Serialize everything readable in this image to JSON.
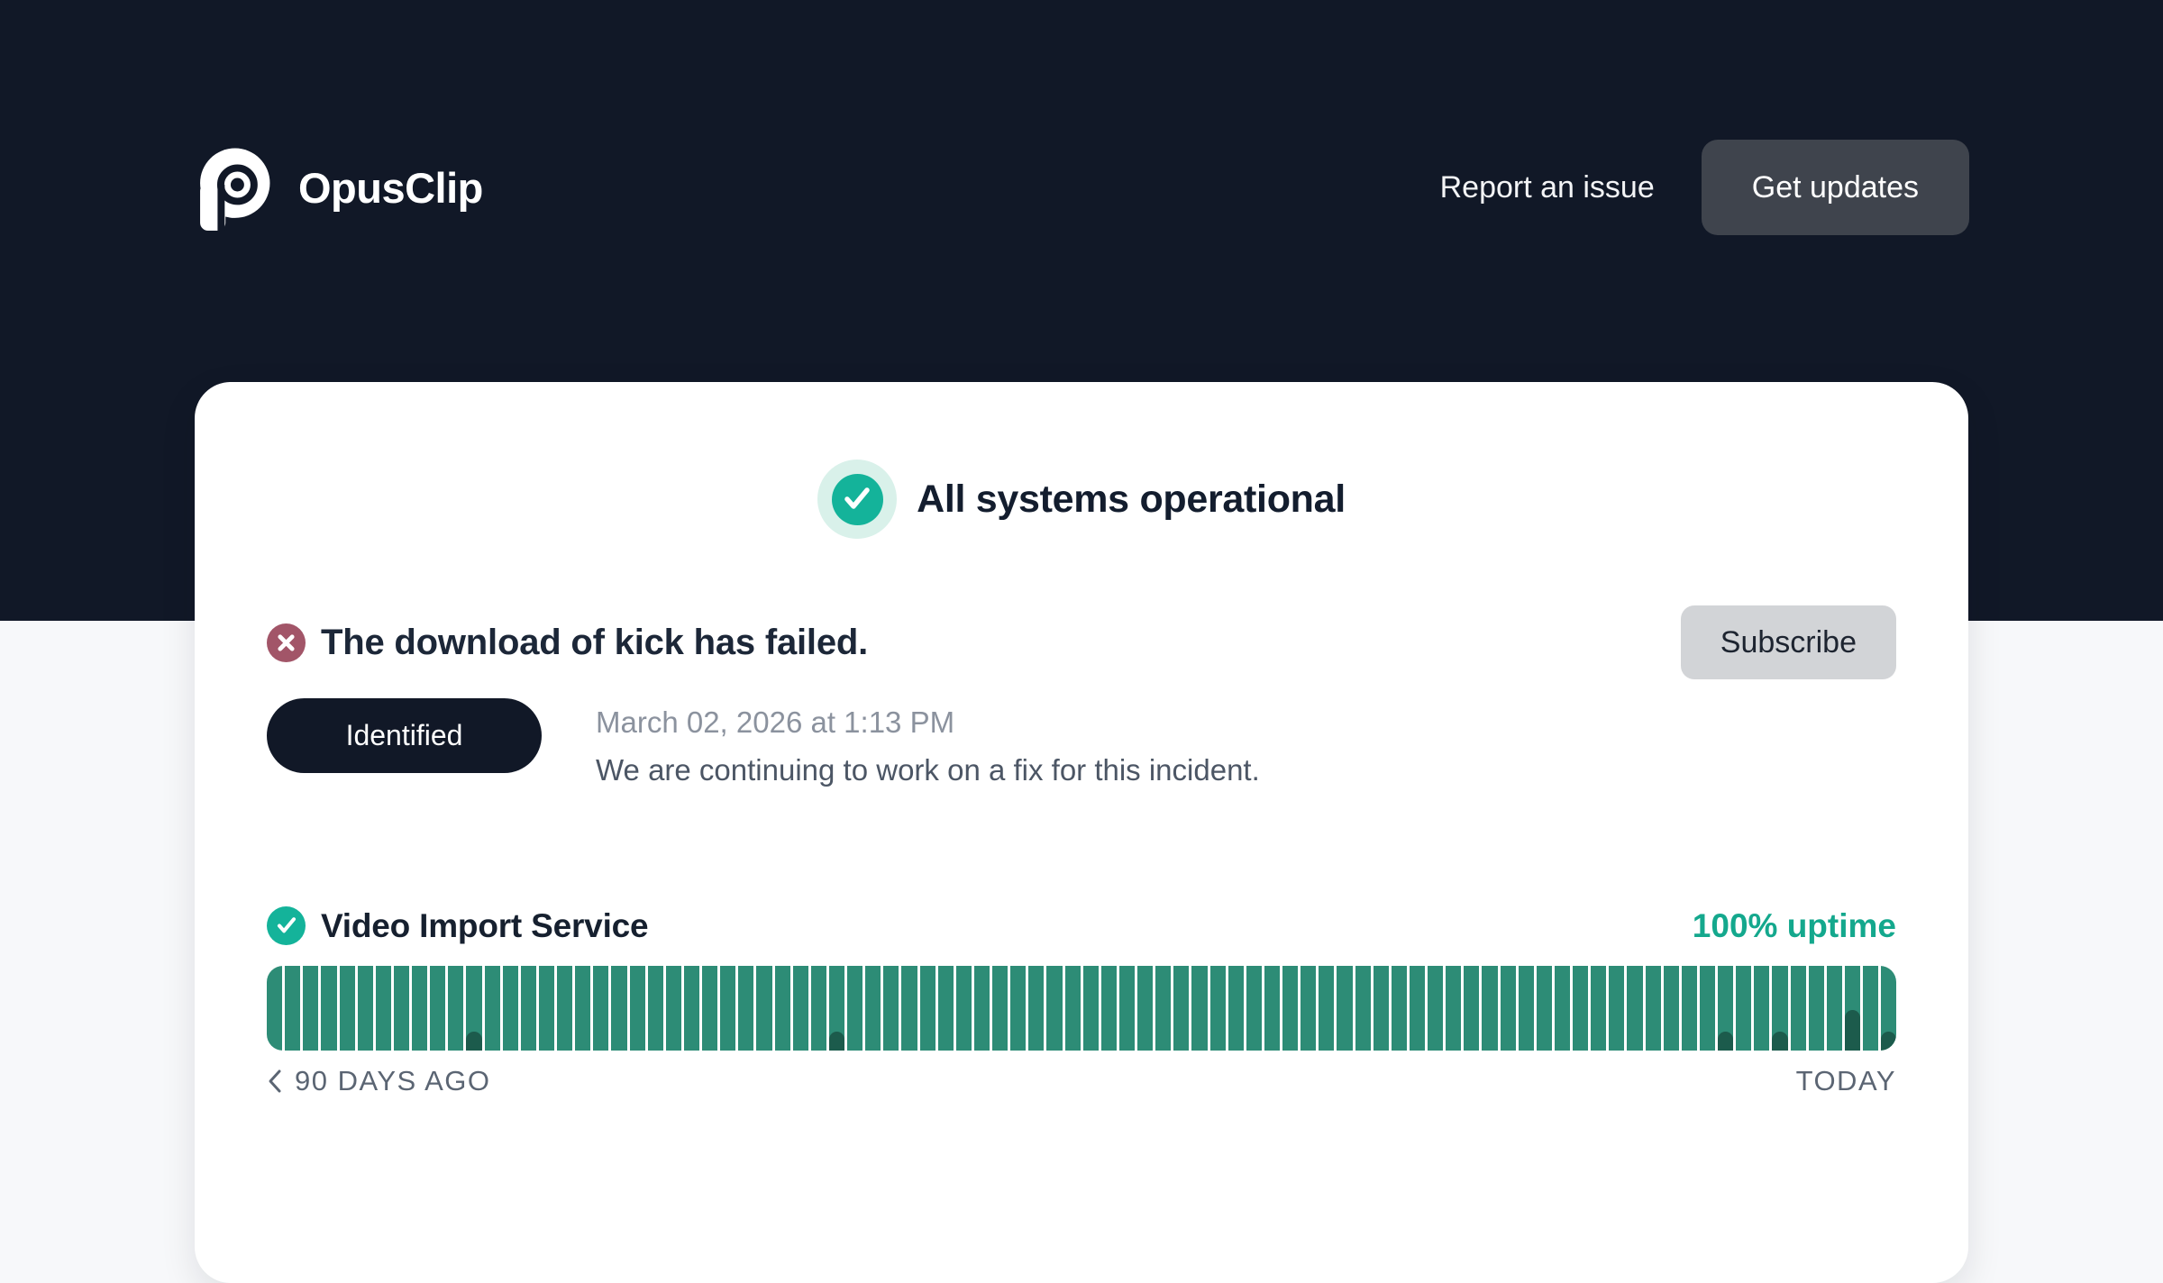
{
  "header": {
    "brand": "OpusClip",
    "report_link": "Report an issue",
    "get_updates_button": "Get updates"
  },
  "status_banner": {
    "label": "All systems operational"
  },
  "incident": {
    "title": "The download of kick has failed.",
    "subscribe_button": "Subscribe",
    "status_badge": "Identified",
    "timestamp": "March 02, 2026 at 1:13 PM",
    "message": "We are continuing to work on a fix for this incident."
  },
  "service": {
    "name": "Video Import Service",
    "uptime_label": "100% uptime"
  },
  "timeline": {
    "left_label": "90 DAYS AGO",
    "right_label": "TODAY"
  },
  "colors": {
    "navy_background": "#111827",
    "teal_status": "#14b39a",
    "teal_uptime_text": "#14a88d",
    "mint_halo": "#d9f1ea",
    "rose_incident": "#a25568",
    "bar_green": "#2d8c76",
    "incident_marker_green": "#1c5b4c"
  },
  "chart_data": {
    "type": "bar",
    "title": "Video Import Service — 90 day uptime history",
    "days": 90,
    "uptime_percent_per_day": 100,
    "ylim": [
      0,
      100
    ],
    "x_axis_labels": [
      "90 DAYS AGO",
      "TODAY"
    ],
    "legend": "none",
    "bar_color": "#2d8c76",
    "marker_color": "#1c5b4c",
    "markers": [
      {
        "day_index": 11,
        "severity": 0.22
      },
      {
        "day_index": 31,
        "severity": 0.22
      },
      {
        "day_index": 80,
        "severity": 0.22
      },
      {
        "day_index": 83,
        "severity": 0.22
      },
      {
        "day_index": 87,
        "severity": 0.48
      },
      {
        "day_index": 89,
        "severity": 0.22
      }
    ]
  }
}
